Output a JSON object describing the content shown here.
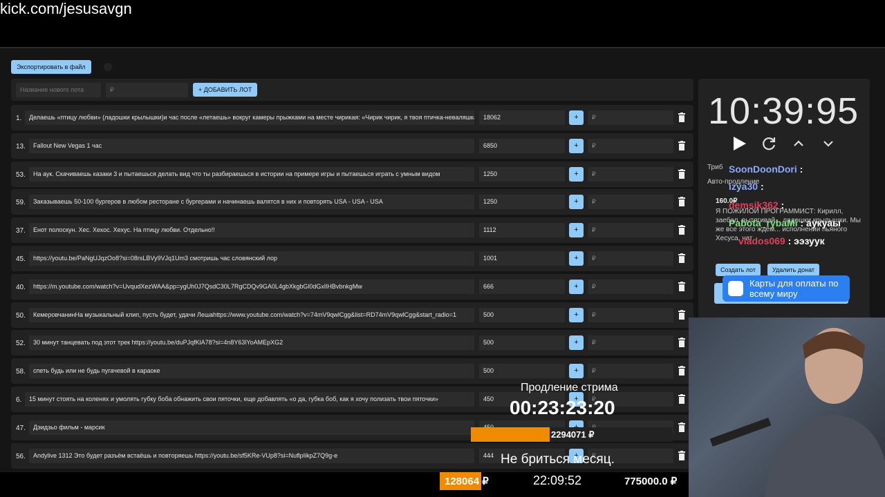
{
  "stream_url": "kick.com/jesusavgn",
  "toolbar": {
    "export_label": "Экспортировать в файл"
  },
  "add_lot": {
    "name_placeholder": "Название нового лота",
    "amount_placeholder": "₽",
    "add_label": "+ ДОБАВИТЬ ЛОТ"
  },
  "lots": [
    {
      "num": "1.",
      "name": "Делаешь «птицу любви» (ладошки крылышки)и час после «летаешь» вокруг камеры прыжками на месте чирикая: «Чирик чирик, я твоя птичка-неваляшка",
      "amount": "18062"
    },
    {
      "num": "13.",
      "name": "Fallout New Vegas 1 час",
      "amount": "6850"
    },
    {
      "num": "53.",
      "name": "На аук. Скачиваешь казаки 3 и пытаешься делать вид что ты разбираешься в истории на примере игры и пытаешься играть с умным видом",
      "amount": "1250"
    },
    {
      "num": "59.",
      "name": "Заказываешь 50-100 бургеров в любом ресторане с бургерами и начинаешь валятся в них и повторять USA - USA - USA",
      "amount": "1250"
    },
    {
      "num": "37.",
      "name": "Енот полоскун. Хес. Хехос. Хехус. На птицу любви. Отдельно!!",
      "amount": "1112"
    },
    {
      "num": "45.",
      "name": "https://youtu.be/PaNgUJqzOo8?si=08rsLBVy9VJq1Um3 смотришь час словянский лор",
      "amount": "1001"
    },
    {
      "num": "40.",
      "name": "https://m.youtube.com/watch?v=UvqudXezWAA&pp=ygUh0J7QsdC30L7RgCDQv9GA0L4gbXkgbGl0dGxlIHBvbnkgMw",
      "amount": "666"
    },
    {
      "num": "50.",
      "name": "КемеровчанинНа музыкальный клип, пусть будет, удачи Лешаhttps://www.youtube.com/watch?v=74mV9qwlCgg&list=RD74mV9qwlCgg&start_radio=1",
      "amount": "500"
    },
    {
      "num": "52.",
      "name": "30 минут танцевать под этот трек https://youtu.be/duPJqfKlA78?si=4n8Y63lYoAMEpXG2",
      "amount": "500"
    },
    {
      "num": "58.",
      "name": "спеть будь или не будь пугачевой в караоке",
      "amount": "500"
    },
    {
      "num": "6.",
      "name": "15 минут стоять на коленях и умолять губку боба обнажить свои пяточки, еще добавлять «о да, губка боб, как я хочу полизать твои пяточки»",
      "amount": "450"
    },
    {
      "num": "47.",
      "name": "Дэидзьо фильм - марсик",
      "amount": "450"
    },
    {
      "num": "56.",
      "name": "Andylive 1312 Это будет разъём встаёшь и повторяешь https://youtu.be/sf5KRe-VUp8?si=NuflpIikpZ7Q9g-e",
      "amount": "444"
    }
  ],
  "rub_placeholder": "₽",
  "timer": {
    "value": "10:39:95"
  },
  "right_panel": {
    "tributes_label": "Триб",
    "auto_extend_label": "Авто-продление",
    "donation_amount": "160.0₽",
    "donation_text": "Я ПОЖИЛОЙ ПРОГРАММИСТ: Кирилл, заебал, вытягивай... ладошки крылышки. Мы же все этого ждём... исполнении пьяного Хесуса, чат",
    "create_lot_label": "Создать лот",
    "delete_donation_label": "Удалить донат"
  },
  "chat": [
    {
      "user": "SoonDoonDori",
      "msg": ":",
      "color": "#8fa8ff"
    },
    {
      "user": "izya30",
      "msg": ":",
      "color": "#8fa8ff"
    },
    {
      "user": "demsik362",
      "msg": ":",
      "color": "#e0405a"
    },
    {
      "user": "Pabota_rybaMi",
      "msg": ": аукуаы",
      "color": "#7ee07e"
    },
    {
      "user": "vlados069",
      "msg": ": ээзуук",
      "color": "#e0405a"
    }
  ],
  "ad": {
    "text": "Карты для оплаты по всему миру"
  },
  "overlay": {
    "extension_title": "Продление стрима",
    "extension_timer": "00:23:23:20",
    "progress_value": "2294071 ₽",
    "progress_fraction": 0.39,
    "subtitle": "Не бриться месяц.",
    "collected": "128064 ₽",
    "clock": "22:09:52",
    "goal": "775000.0 ₽"
  },
  "colors": {
    "accent": "#90caf9",
    "orange": "#f08a00",
    "panel": "#222222",
    "background": "#151515"
  }
}
